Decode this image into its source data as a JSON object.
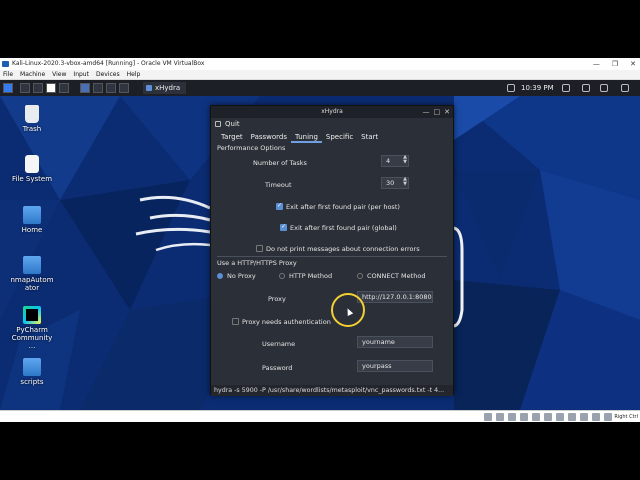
{
  "host": {
    "title": "Kali-Linux-2020.3-vbox-amd64 [Running] - Oracle VM VirtualBox",
    "controls": [
      "—",
      "❐",
      "✕"
    ],
    "menu": [
      "File",
      "Machine",
      "View",
      "Input",
      "Devices",
      "Help"
    ],
    "right_ctrl": "Right Ctrl"
  },
  "guest": {
    "taskbar": {
      "task_title": "xHydra",
      "clock": "10:39 PM"
    },
    "desktop_icons": [
      {
        "label": "Trash"
      },
      {
        "label": "File System"
      },
      {
        "label": "Home"
      },
      {
        "label": "nmapAutomator"
      },
      {
        "label": "PyCharm Community ..."
      },
      {
        "label": "scripts"
      }
    ]
  },
  "xhydra": {
    "title": "xHydra",
    "controls": [
      "—",
      "□",
      "✕"
    ],
    "menu_quit": "Quit",
    "tabs": [
      "Target",
      "Passwords",
      "Tuning",
      "Specific",
      "Start"
    ],
    "active_tab": "Tuning",
    "performance_header": "Performance Options",
    "tasks_label": "Number of Tasks",
    "tasks_value": "4",
    "timeout_label": "Timeout",
    "timeout_value": "30",
    "exit_host_label": "Exit after first found pair (per host)",
    "exit_global_label": "Exit after first found pair (global)",
    "no_errors_label": "Do not print messages about connection errors",
    "proxy_header": "Use a HTTP/HTTPS Proxy",
    "proxy_options": [
      "No Proxy",
      "HTTP Method",
      "CONNECT Method"
    ],
    "proxy_label": "Proxy",
    "proxy_value": "http://127.0.0.1:8080",
    "proxy_auth_label": "Proxy needs authentication",
    "username_label": "Username",
    "username_value": "yourname",
    "password_label": "Password",
    "password_value": "yourpass",
    "command_line": "hydra -s 5900 -P /usr/share/wordlists/metasploit/vnc_passwords.txt -t 4..."
  },
  "colors": {
    "accent": "#5b8fd6",
    "cursor_ring": "#f2d034",
    "window_bg": "#2b2f37"
  }
}
